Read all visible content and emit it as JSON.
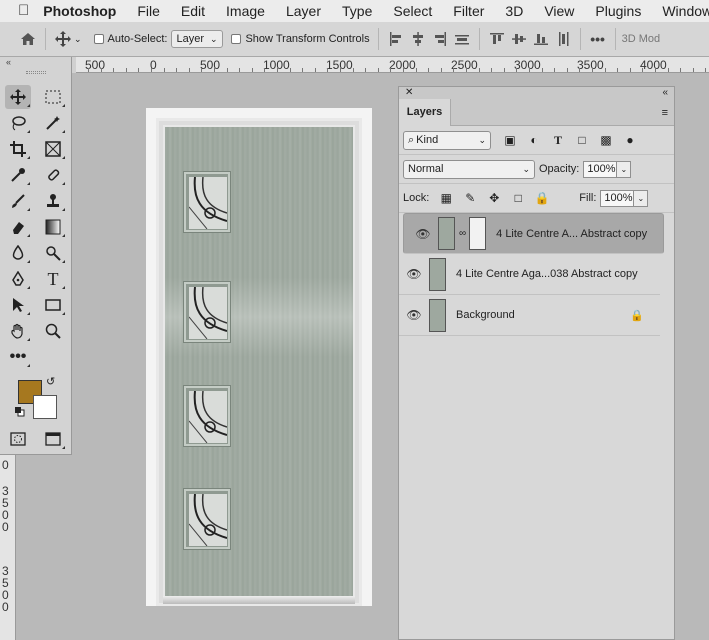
{
  "menubar": {
    "app": "Photoshop",
    "items": [
      "File",
      "Edit",
      "Image",
      "Layer",
      "Type",
      "Select",
      "Filter",
      "3D",
      "View",
      "Plugins",
      "Window"
    ]
  },
  "options": {
    "auto_select_label": "Auto-Select:",
    "auto_select_value": "Layer",
    "transform_label": "Show Transform Controls",
    "mode_3d": "3D Mod"
  },
  "ruler_h": [
    "500",
    "0",
    "500",
    "1000",
    "1500",
    "2000",
    "2500",
    "3000",
    "3500",
    "4000"
  ],
  "ruler_v": [
    "0",
    "3",
    "5",
    "0",
    "0",
    "3",
    "5",
    "0",
    "0"
  ],
  "colors": {
    "foreground": "#a6781f",
    "background": "#ffffff"
  },
  "layers_panel": {
    "tab": "Layers",
    "filter_kind": "Kind",
    "blend_mode": "Normal",
    "opacity_label": "Opacity:",
    "opacity_value": "100%",
    "lock_label": "Lock:",
    "fill_label": "Fill:",
    "fill_value": "100%",
    "layers": [
      {
        "name": "4 Lite Centre A... Abstract copy",
        "selected": true,
        "has_mask": true
      },
      {
        "name": "4 Lite Centre Aga...038 Abstract copy",
        "selected": false
      },
      {
        "name": "Background",
        "selected": false,
        "locked": true
      }
    ]
  },
  "icons": {
    "apple": "apple-icon",
    "home": "home-icon",
    "move": "move-icon",
    "eye": "visibility-eye-icon",
    "lock": "lock-icon"
  }
}
